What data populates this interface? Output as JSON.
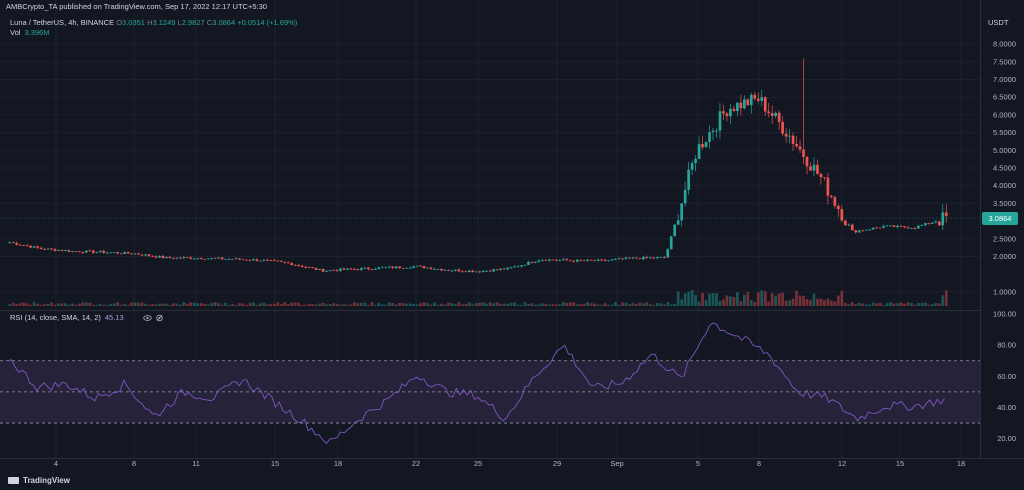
{
  "header": {
    "publisher": "AMBCrypto_TA published on TradingView.com, Sep 17, 2022 12:17 UTC+5:30"
  },
  "legend": {
    "symbol": "Luna / TetherUS, 4h, BINANCE",
    "open_label": "O",
    "open": "3.0351",
    "high_label": "H",
    "high": "3.1249",
    "low_label": "L",
    "low": "2.9827",
    "close_label": "C",
    "close": "3.0864",
    "change": "+0.0514 (+1.69%)",
    "vol_label": "Vol",
    "vol_value": "3.396M"
  },
  "rsi_legend": {
    "label": "RSI (14, close, SMA, 14, 2)",
    "value": "45.13"
  },
  "price_axis": {
    "currency": "USDT",
    "current_price": "3.0864",
    "ticks": [
      "8.0000",
      "7.5000",
      "7.0000",
      "6.5000",
      "6.0000",
      "5.5000",
      "5.0000",
      "4.5000",
      "4.0000",
      "3.5000",
      "2.5000",
      "2.0000",
      "1.0000"
    ]
  },
  "rsi_axis": {
    "ticks": [
      "100.00",
      "80.00",
      "60.00",
      "40.00",
      "20.00"
    ]
  },
  "time_axis": {
    "labels": [
      "4",
      "8",
      "11",
      "15",
      "18",
      "22",
      "25",
      "29",
      "Sep",
      "5",
      "8",
      "12",
      "15",
      "18"
    ]
  },
  "footer": {
    "brand": "TradingView"
  },
  "colors": {
    "bull": "#26a69a",
    "bear": "#ef5350",
    "rsi_line": "#7e57c2",
    "rsi_band": "#2a2640",
    "background": "#131722"
  },
  "icons": [
    "eye-icon",
    "gear-icon",
    "tradingview-logo-icon"
  ],
  "chart_data": [
    {
      "type": "candlestick",
      "title": "Luna / TetherUS, 4h, BINANCE",
      "ylim": [
        0.6,
        8.4
      ],
      "x_labels": [
        "4",
        "8",
        "11",
        "15",
        "18",
        "22",
        "25",
        "29",
        "Sep",
        "5",
        "8",
        "12",
        "15",
        "18"
      ],
      "series_approx_close": [
        {
          "x": "1",
          "close": 2.4
        },
        {
          "x": "3",
          "close": 2.22
        },
        {
          "x": "5",
          "close": 2.15
        },
        {
          "x": "7",
          "close": 2.12
        },
        {
          "x": "9",
          "close": 2.08
        },
        {
          "x": "10",
          "close": 1.96
        },
        {
          "x": "12",
          "close": 1.96
        },
        {
          "x": "14",
          "close": 1.93
        },
        {
          "x": "16",
          "close": 1.9
        },
        {
          "x": "18",
          "close": 1.8
        },
        {
          "x": "19",
          "close": 1.6
        },
        {
          "x": "21",
          "close": 1.64
        },
        {
          "x": "23",
          "close": 1.68
        },
        {
          "x": "25",
          "close": 1.72
        },
        {
          "x": "27",
          "close": 1.62
        },
        {
          "x": "29",
          "close": 1.58
        },
        {
          "x": "30",
          "close": 1.66
        },
        {
          "x": "Sep 1",
          "close": 1.92
        },
        {
          "x": "Sep 3",
          "close": 1.88
        },
        {
          "x": "Sep 5",
          "close": 1.88
        },
        {
          "x": "Sep 7",
          "close": 1.95
        },
        {
          "x": "Sep 8",
          "close": 1.97
        },
        {
          "x": "Sep 9",
          "close": 5.0
        },
        {
          "x": "Sep 10",
          "close": 6.2
        },
        {
          "x": "Sep 11",
          "close": 6.45
        },
        {
          "x": "Sep 12",
          "close": 5.4
        },
        {
          "x": "Sep 13",
          "close": 4.2
        },
        {
          "x": "Sep 14",
          "close": 2.7
        },
        {
          "x": "Sep 15",
          "close": 2.85
        },
        {
          "x": "Sep 16",
          "close": 2.82
        },
        {
          "x": "Sep 17",
          "close": 3.09
        }
      ],
      "peak_high": 7.6,
      "last_close": 3.0864
    },
    {
      "type": "line",
      "title": "RSI (14, close, SMA, 14, 2)",
      "ylim": [
        14,
        100
      ],
      "bands": [
        30,
        50,
        70
      ],
      "series_approx": [
        {
          "x": "1",
          "rsi": 72
        },
        {
          "x": "2",
          "rsi": 53
        },
        {
          "x": "4",
          "rsi": 55
        },
        {
          "x": "6",
          "rsi": 46
        },
        {
          "x": "8",
          "rsi": 55
        },
        {
          "x": "10",
          "rsi": 34
        },
        {
          "x": "12",
          "rsi": 50
        },
        {
          "x": "14",
          "rsi": 46
        },
        {
          "x": "15",
          "rsi": 58
        },
        {
          "x": "17",
          "rsi": 45
        },
        {
          "x": "18",
          "rsi": 32
        },
        {
          "x": "19",
          "rsi": 17
        },
        {
          "x": "21",
          "rsi": 33
        },
        {
          "x": "23",
          "rsi": 45
        },
        {
          "x": "24",
          "rsi": 61
        },
        {
          "x": "26",
          "rsi": 50
        },
        {
          "x": "28",
          "rsi": 48
        },
        {
          "x": "29",
          "rsi": 33
        },
        {
          "x": "30",
          "rsi": 60
        },
        {
          "x": "Sep 1",
          "rsi": 80
        },
        {
          "x": "Sep 3",
          "rsi": 52
        },
        {
          "x": "Sep 5",
          "rsi": 56
        },
        {
          "x": "Sep 6",
          "rsi": 74
        },
        {
          "x": "Sep 8",
          "rsi": 58
        },
        {
          "x": "Sep 9",
          "rsi": 95
        },
        {
          "x": "Sep 10",
          "rsi": 85
        },
        {
          "x": "Sep 11",
          "rsi": 74
        },
        {
          "x": "Sep 12",
          "rsi": 50
        },
        {
          "x": "Sep 13",
          "rsi": 46
        },
        {
          "x": "Sep 14",
          "rsi": 33
        },
        {
          "x": "Sep 15",
          "rsi": 41
        },
        {
          "x": "Sep 16",
          "rsi": 41
        },
        {
          "x": "Sep 17",
          "rsi": 45
        }
      ]
    }
  ]
}
